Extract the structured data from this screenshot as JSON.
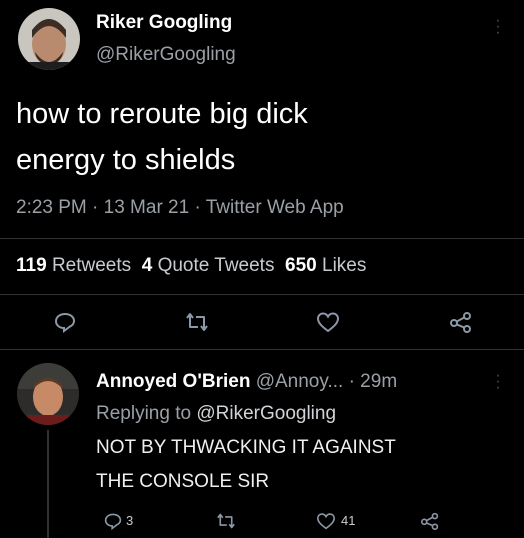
{
  "tweet": {
    "display_name": "Riker Googling",
    "handle": "@RikerGoogling",
    "text_line1": "how to reroute big dick",
    "text_line2": "energy to shields",
    "meta": "2:23 PM · 13 Mar 21 · Twitter Web App",
    "retweets_count": "119",
    "retweets_label": "Retweets",
    "quotes_count": "4",
    "quotes_label": "Quote Tweets",
    "likes_count": "650",
    "likes_label": "Likes"
  },
  "reply": {
    "display_name": "Annoyed O'Brien",
    "handle": "@Annoy...",
    "time": "· 29m",
    "replying_prefix": "Replying to",
    "replying_handle": "@RikerGoogling",
    "text_line1": "NOT BY THWACKING IT AGAINST",
    "text_line2": "THE CONSOLE SIR",
    "reply_count": "3",
    "like_count": "41"
  },
  "colors": {
    "background": "#000000",
    "text": "#ffffff",
    "muted": "#9aa0a6",
    "divider": "#2f3336",
    "icon": "#8b98a5"
  },
  "icons": [
    "reply-icon",
    "retweet-icon",
    "like-icon",
    "share-icon",
    "more-icon"
  ]
}
